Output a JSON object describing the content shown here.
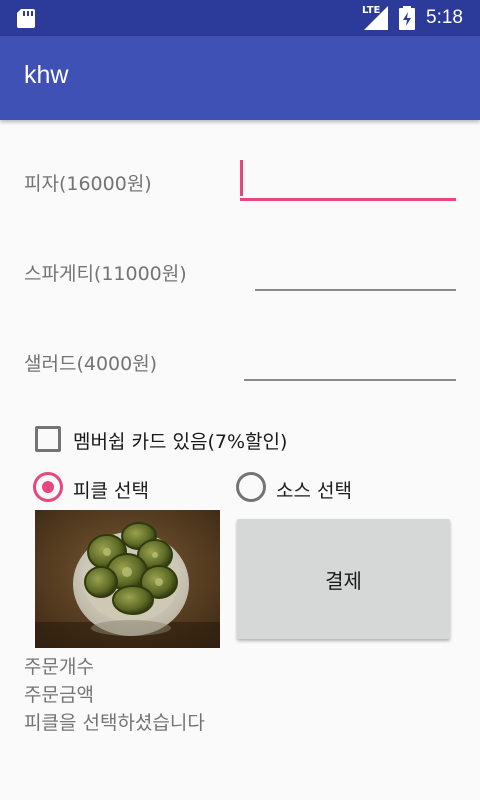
{
  "status_bar": {
    "network": "LTE",
    "time": "5:18"
  },
  "app_bar": {
    "title": "khw"
  },
  "items": [
    {
      "label": "피자(16000원)",
      "value": ""
    },
    {
      "label": "스파게티(11000원)",
      "value": ""
    },
    {
      "label": "샐러드(4000원)",
      "value": ""
    }
  ],
  "membership": {
    "label": "멤버쉽 카드 있음(7%할인)",
    "checked": false
  },
  "radios": [
    {
      "label": "피클 선택",
      "checked": true
    },
    {
      "label": "소스 선택",
      "checked": false
    }
  ],
  "pay_button": {
    "label": "결제"
  },
  "info": {
    "order_count": "주문개수",
    "order_amount": "주문금액",
    "selection_message": "피클을 선택하셨습니다"
  },
  "colors": {
    "status_bar": "#2c3b99",
    "app_bar": "#3f51b5",
    "accent": "#e8467e",
    "button": "#d6d7d7"
  }
}
